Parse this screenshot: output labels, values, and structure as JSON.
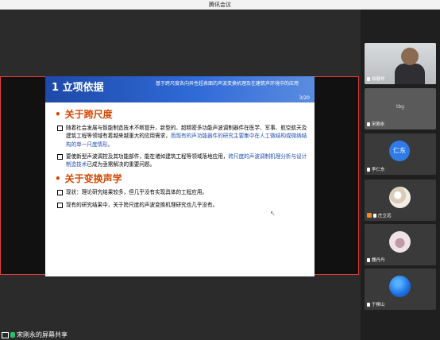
{
  "window": {
    "title": "腾讯会议"
  },
  "share_banner": {
    "label": "宋刚永的屏幕共享"
  },
  "slide": {
    "section": "1 立项依据",
    "topic": "基于跨尺度各向异性超表面的声波变换机理及在建筑声环境中的应用",
    "page": "3/20",
    "bullets": [
      {
        "title": "关于跨尺度",
        "paras": [
          {
            "text": "随着社会发展与智能制造技术不断提升，新型的、超精密多功能声波调制器件在医学、军事、航空航天及建筑工程等领域有着越来越重大的应用需求，",
            "highlight": "而现有的声功能器件的研究主要集中在人工微结构或微纳结构的单一尺度情形。"
          },
          {
            "text": "要使新型声波调控及其功能部件，能在诸如建筑工程等领域落地应用，",
            "highlight": "跨尺度的声波调制机理分析与设计制造技术",
            "tail": "已成为亟需解决的重要问题。"
          }
        ]
      },
      {
        "title": "关于变换声学",
        "paras": [
          {
            "text": "现状：理论研究结果较多，但几乎没有实现具体的工程应用。"
          },
          {
            "text": "现有的研究结果中，关于跨尺度的声波变换机理研究也几乎没有。"
          }
        ]
      }
    ]
  },
  "participants": [
    {
      "name": "徐春祥",
      "kind": "video"
    },
    {
      "name": "宋刚永",
      "kind": "placeholder",
      "center_text": "tbg"
    },
    {
      "name": "李仁东",
      "kind": "avatar-text",
      "avatar_text": "仁东"
    },
    {
      "name": "庄立远",
      "kind": "avatar-image"
    },
    {
      "name": "魏丹丹",
      "kind": "avatar-image"
    },
    {
      "name": "于楔山",
      "kind": "avatar-image"
    }
  ],
  "colors": {
    "accent_red": "#e53a3a",
    "slide_header": "#1e49a8",
    "bullet_orange": "#d64500",
    "highlight_blue": "#1f4fb0"
  }
}
